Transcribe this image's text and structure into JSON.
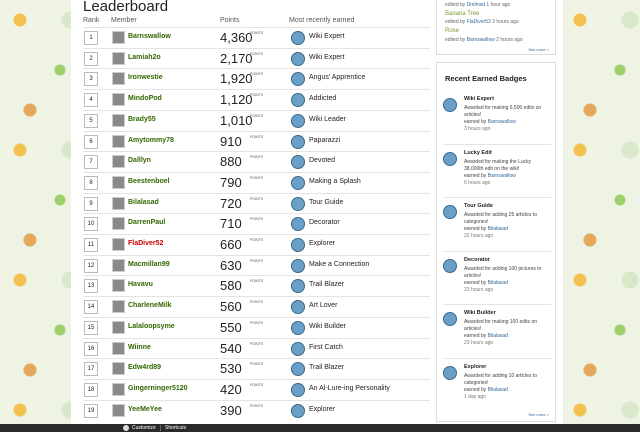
{
  "page_title": "Leaderboard",
  "columns": {
    "rank": "Rank",
    "member": "Member",
    "points": "Points",
    "earned": "Most recently earned"
  },
  "points_label": "POINTS",
  "rows": [
    {
      "rank": "1",
      "member": "Barnswallow",
      "points": "4,360",
      "badge": "Wiki Expert"
    },
    {
      "rank": "2",
      "member": "Lamiah2o",
      "points": "2,170",
      "badge": "Wiki Expert"
    },
    {
      "rank": "3",
      "member": "Ironwestie",
      "points": "1,920",
      "badge": "Angus' Apprentice"
    },
    {
      "rank": "4",
      "member": "MindoPod",
      "points": "1,120",
      "badge": "Addicted"
    },
    {
      "rank": "5",
      "member": "Brady55",
      "points": "1,010",
      "badge": "Wiki Leader"
    },
    {
      "rank": "6",
      "member": "Amytommy78",
      "points": "910",
      "badge": "Paparazzi"
    },
    {
      "rank": "7",
      "member": "Dalllyn",
      "points": "880",
      "badge": "Devoted"
    },
    {
      "rank": "8",
      "member": "Beestenboel",
      "points": "790",
      "badge": "Making a Splash"
    },
    {
      "rank": "9",
      "member": "Bilalasad",
      "points": "720",
      "badge": "Tour Guide"
    },
    {
      "rank": "10",
      "member": "DarrenPaul",
      "points": "710",
      "badge": "Decorator"
    },
    {
      "rank": "11",
      "member": "FlaDiver52",
      "points": "660",
      "badge": "Explorer"
    },
    {
      "rank": "12",
      "member": "Macmillan99",
      "points": "630",
      "badge": "Make a Connection"
    },
    {
      "rank": "13",
      "member": "Havavu",
      "points": "580",
      "badge": "Trail Blazer"
    },
    {
      "rank": "14",
      "member": "CharleneMilk",
      "points": "560",
      "badge": "Art Lover"
    },
    {
      "rank": "15",
      "member": "Lalaloopsyme",
      "points": "550",
      "badge": "Wiki Builder"
    },
    {
      "rank": "16",
      "member": "Wiinne",
      "points": "540",
      "badge": "First Catch"
    },
    {
      "rank": "17",
      "member": "Edw4rd89",
      "points": "530",
      "badge": "Trail Blazer"
    },
    {
      "rank": "18",
      "member": "Gingerninger5120",
      "points": "420",
      "badge": "An Al-Lure-ing Personality"
    },
    {
      "rank": "19",
      "member": "YeeMeYee",
      "points": "390",
      "badge": "Explorer"
    }
  ],
  "activity": {
    "line1_pre": "edited by",
    "line1_user": "Dmlmsd",
    "line1_time": "1 hour ago",
    "item2": "Banana Tree",
    "line2_pre": "edited by",
    "line2_user": "FlaDiver52",
    "line2_time": "2 hours ago",
    "item3": "Rose",
    "line3_pre": "edited by",
    "line3_user": "Barnswallow",
    "line3_time": "2 hours ago",
    "more": "See more >"
  },
  "recent": {
    "title": "Recent Earned Badges",
    "more": "See more >",
    "earned_by": "earned by",
    "badges": [
      {
        "name": "Wiki Expert",
        "desc": "Awarded for making 6,500 edits on articles!",
        "user": "Barnswallow",
        "time": "3 hours ago"
      },
      {
        "name": "Lucky Edit",
        "desc": "Awarded for making the Lucky 38,000th edit on the wiki!",
        "user": "Barnswallow",
        "time": "6 hours ago"
      },
      {
        "name": "Tour Guide",
        "desc": "Awarded for adding 25 articles to categories!",
        "user": "Bilalasad",
        "time": "22 hours ago"
      },
      {
        "name": "Decorator",
        "desc": "Awarded for adding 100 pictures to articles!",
        "user": "Bilalasad",
        "time": "23 hours ago"
      },
      {
        "name": "Wiki Builder",
        "desc": "Awarded for making 100 edits on articles!",
        "user": "Bilalasad",
        "time": "23 hours ago"
      },
      {
        "name": "Explorer",
        "desc": "Awarded for adding 10 articles to categories!",
        "user": "Bilalasad",
        "time": "1 day ago"
      }
    ]
  },
  "toolbar": {
    "customize": "Customize",
    "shortcuts": "Shortcuts"
  }
}
